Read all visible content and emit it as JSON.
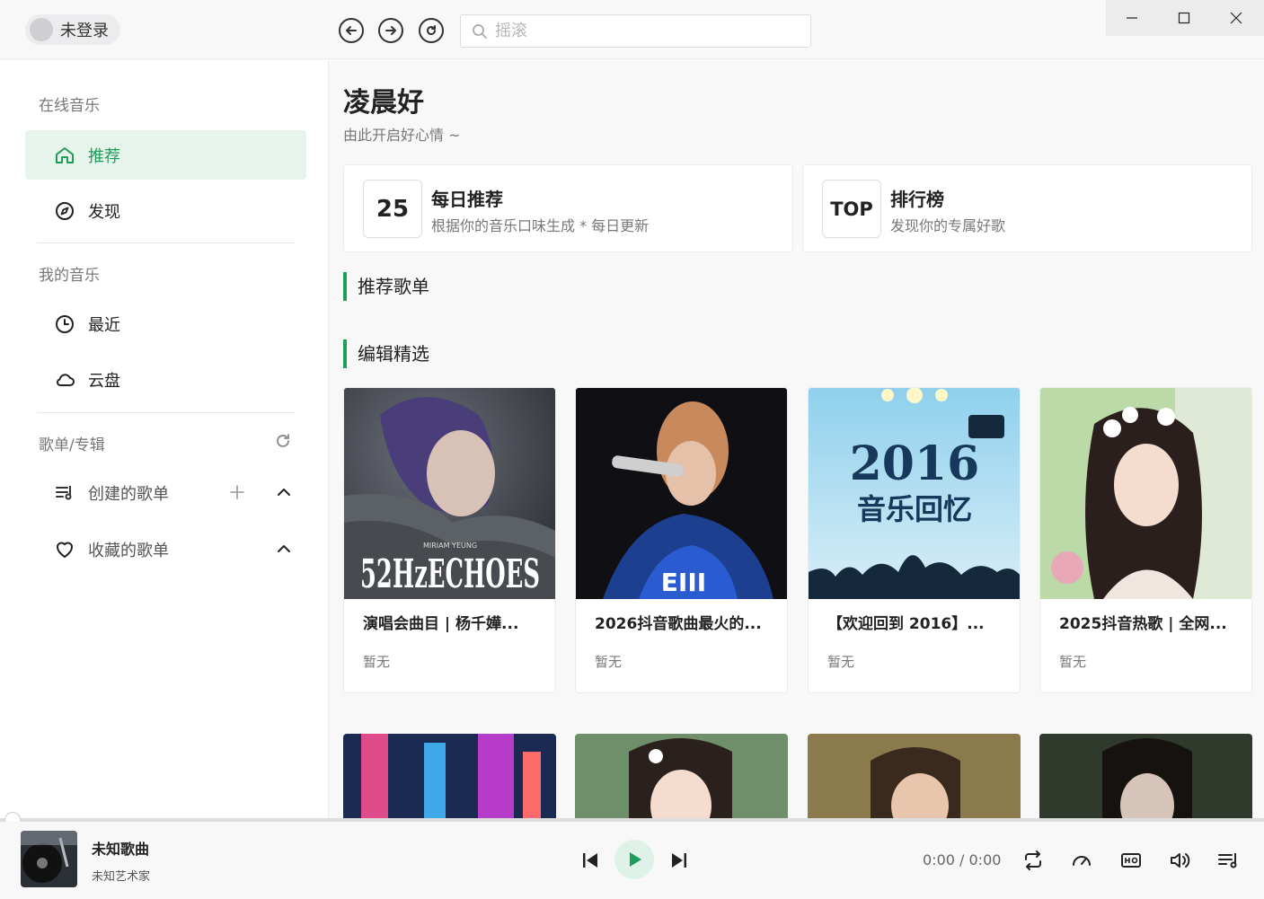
{
  "header": {
    "user_name": "未登录",
    "search_placeholder": "摇滚"
  },
  "sidebar": {
    "online_title": "在线音乐",
    "items_online": [
      {
        "label": "推荐",
        "icon": "home-icon",
        "active": true
      },
      {
        "label": "发现",
        "icon": "compass-icon",
        "active": false
      }
    ],
    "my_title": "我的音乐",
    "items_my": [
      {
        "label": "最近",
        "icon": "clock-icon"
      },
      {
        "label": "云盘",
        "icon": "cloud-icon"
      }
    ],
    "playlist_title": "歌单/专辑",
    "created_label": "创建的歌单",
    "collected_label": "收藏的歌单"
  },
  "main": {
    "greeting": "凌晨好",
    "greeting_sub": "由此开启好心情 ~",
    "cards": [
      {
        "badge": "25",
        "title": "每日推荐",
        "desc": "根据你的音乐口味生成 * 每日更新"
      },
      {
        "badge": "TOP",
        "title": "排行榜",
        "desc": "发现你的专属好歌"
      }
    ],
    "section_recommended": "推荐歌单",
    "section_editor": "编辑精选",
    "playlists": [
      {
        "title": "演唱会曲目 | 杨千嬅...",
        "sub": "暂无",
        "cover_text": "52HzECHOES",
        "cover_small": "MIRIAM YEUNG"
      },
      {
        "title": "2026抖音歌曲最火的...",
        "sub": "暂无"
      },
      {
        "title": "【欢迎回到 2016】...",
        "sub": "暂无",
        "cover_year": "2016",
        "cover_text2": "音乐回忆"
      },
      {
        "title": "2025抖音热歌 | 全网...",
        "sub": "暂无"
      }
    ]
  },
  "player": {
    "song": "未知歌曲",
    "artist": "未知艺术家",
    "time": "0:00 / 0:00",
    "progress": 0
  },
  "colors": {
    "accent": "#1e9c5a",
    "active_bg": "#e6f4ec"
  }
}
